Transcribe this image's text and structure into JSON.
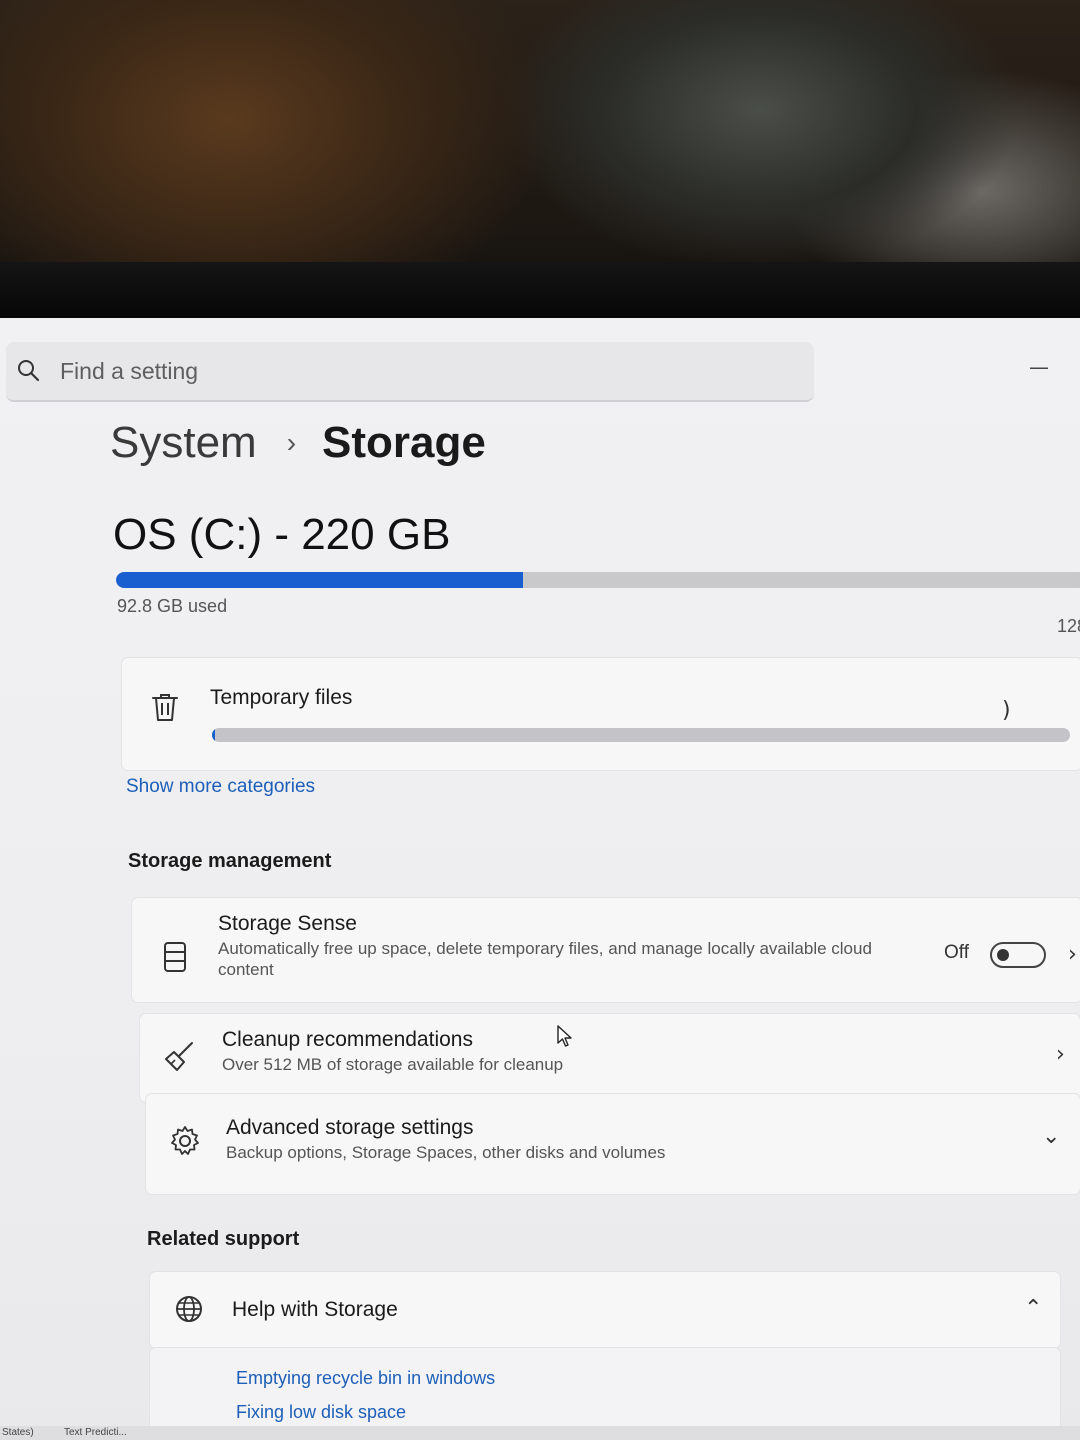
{
  "search": {
    "placeholder": "Find a setting"
  },
  "window": {
    "minimize_glyph": "—"
  },
  "breadcrumb": {
    "parent": "System",
    "separator": "›",
    "current": "Storage"
  },
  "drive": {
    "title": "OS (C:) - 220 GB",
    "used_label": "92.8 GB used",
    "total_label_partial": "128",
    "used_fraction": 0.42
  },
  "temporary_files": {
    "title": "Temporary files",
    "chevron": ")",
    "fill_fraction": 0.003
  },
  "show_more": "Show more categories",
  "storage_management": {
    "heading": "Storage management",
    "storage_sense": {
      "title": "Storage Sense",
      "description": "Automatically free up space, delete temporary files, and manage locally available cloud content",
      "toggle_state": "Off",
      "chevron": "›"
    },
    "cleanup": {
      "title": "Cleanup recommendations",
      "description": "Over 512 MB of storage available for cleanup",
      "chevron": "›"
    },
    "advanced": {
      "title": "Advanced storage settings",
      "description": "Backup options, Storage Spaces, other disks and volumes",
      "chevron": "⌄"
    }
  },
  "related_support": {
    "heading": "Related support",
    "help": {
      "title": "Help with Storage",
      "chevron": "⌃"
    },
    "links": [
      "Emptying recycle bin in windows",
      "Fixing low disk space"
    ]
  },
  "taskbar_peek": {
    "item1": "States)",
    "item2": "Text Predicti..."
  },
  "colors": {
    "accent": "#1a5fcf",
    "link": "#1d5fb8"
  },
  "icons": {
    "search": "search-icon",
    "temporary_files": "trash-icon",
    "storage_sense": "drive-icon",
    "cleanup": "broom-icon",
    "advanced": "gear-icon",
    "help": "globe-icon"
  }
}
